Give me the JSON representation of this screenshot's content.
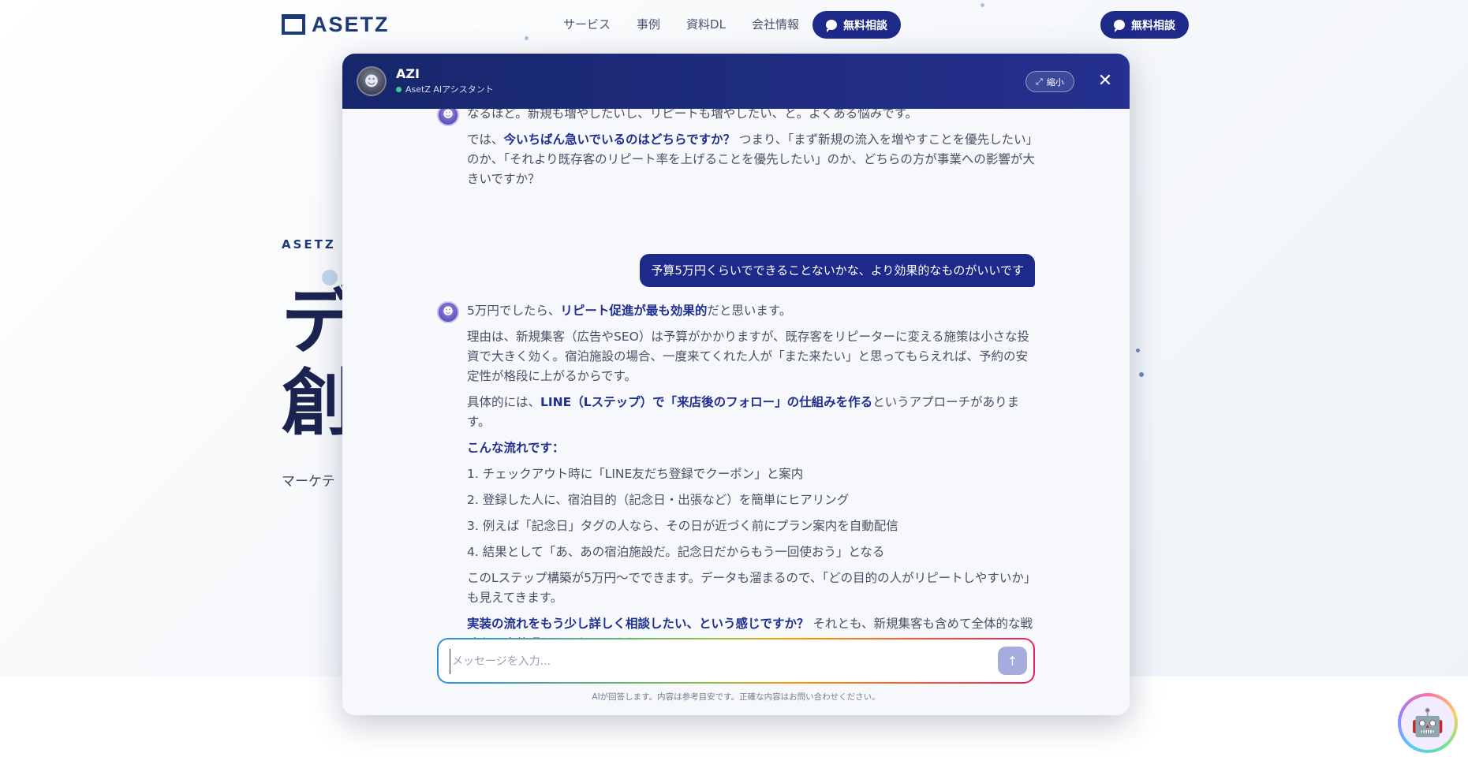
{
  "site": {
    "logo_text": "ASETZ",
    "nav": [
      "サービス",
      "事例",
      "資料DL",
      "会社情報"
    ],
    "nav_cta": "無料相談",
    "right_cta": "無料相談"
  },
  "hero": {
    "kicker": "ASETZ M",
    "line1": "デ",
    "line2": "創",
    "sub": "マーケテ"
  },
  "chat": {
    "bot_name": "AZI",
    "bot_status": "AsetZ AIアシスタント",
    "shrink_label": "縮小",
    "close_label": "✕",
    "messages": {
      "m1_line": "なるほど。新規も増やしたいし、リピートも増やしたい、と。よくある悩みです。",
      "m1_p2_a": "では、",
      "m1_p2_strong": "今いちばん急いでいるのはどちらですか？",
      "m1_p2_b": " つまり、「まず新規の流入を増やすことを優先したい」のか、「それより既存客のリピート率を上げることを優先したい」のか、どちらの方が事業への影響が大きいですか？",
      "user_msg": "予算5万円くらいでできることないかな、より効果的なものがいいです",
      "m2_p1_a": "5万円でしたら、",
      "m2_p1_strong": "リピート促進が最も効果的",
      "m2_p1_b": "だと思います。",
      "m2_p2": "理由は、新規集客（広告やSEO）は予算がかかりますが、既存客をリピーターに変える施策は小さな投資で大きく効く。宿泊施設の場合、一度来てくれた人が「また来たい」と思ってもらえれば、予約の安定性が格段に上がるからです。",
      "m2_p3_a": "具体的には、",
      "m2_p3_strong": "LINE（Lステップ）で「来店後のフォロー」の仕組みを作る",
      "m2_p3_b": "というアプローチがあります。",
      "m2_heading": "こんな流れです：",
      "m2_list": [
        "1. チェックアウト時に「LINE友だち登録でクーポン」と案内",
        "2. 登録した人に、宿泊目的（記念日・出張など）を簡単にヒアリング",
        "3. 例えば「記念日」タグの人なら、その日が近づく前にプラン案内を自動配信",
        "4. 結果として「あ、あの宿泊施設だ。記念日だからもう一回使おう」となる"
      ],
      "m2_p4": "このLステップ構築が5万円〜でできます。データも溜まるので、「どの目的の人がリピートしやすいか」も見えてきます。",
      "m2_p5_strong": "実装の流れをもう少し詳しく相談したい、という感じですか？",
      "m2_p5_b": " それとも、新規集客も含めて全体的な戦略を一度整理してみたいですか？"
    },
    "input_placeholder": "メッセージを入力...",
    "disclaimer": "AIが回答します。内容は参考目安です。正確な内容はお問い合わせください。"
  },
  "icons": {
    "chat_bubble": "chat-bubble-icon",
    "expand": "expand-icon",
    "close": "close-icon",
    "send": "arrow-up-icon",
    "bot": "robot-icon"
  },
  "colors": {
    "brand_navy": "#1e2a8a",
    "accent_text": "#1e2f8f",
    "status_green": "#3ccf8e"
  }
}
